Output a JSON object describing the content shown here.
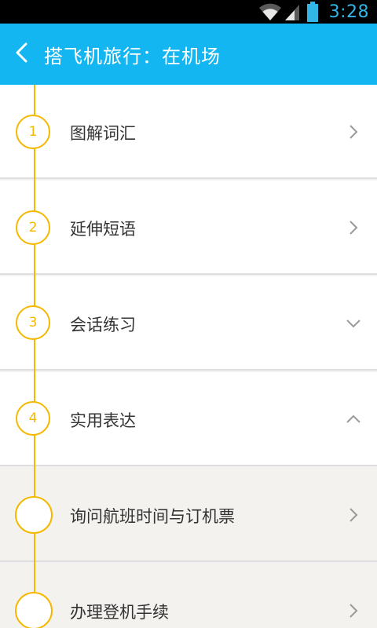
{
  "status_bar": {
    "time": "3:28",
    "icons": [
      "wifi-icon",
      "signal-icon",
      "battery-icon"
    ]
  },
  "header": {
    "title": "搭飞机旅行：在机场",
    "back_icon": "chevron-left-icon"
  },
  "colors": {
    "header_bg": "#14b6f2",
    "accent": "#f5b800",
    "clock": "#33b5e5"
  },
  "sections": [
    {
      "number": "1",
      "label": "图解词汇",
      "chevron": "chevron-right-icon"
    },
    {
      "number": "2",
      "label": "延伸短语",
      "chevron": "chevron-right-icon"
    },
    {
      "number": "3",
      "label": "会话练习",
      "chevron": "chevron-down-icon"
    },
    {
      "number": "4",
      "label": "实用表达",
      "chevron": "chevron-up-icon"
    }
  ],
  "sub_items": [
    {
      "label": "询问航班时间与订机票",
      "chevron": "chevron-right-icon"
    },
    {
      "label": "办理登机手续",
      "chevron": "chevron-right-icon"
    }
  ]
}
